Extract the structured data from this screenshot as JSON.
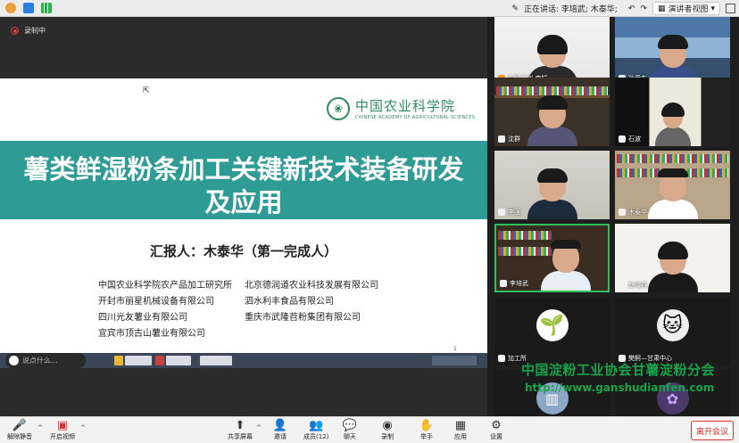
{
  "topbar": {
    "speaker_text": "正在讲话: 李培武; 木泰华;",
    "view_button": "演讲者视图"
  },
  "recording": {
    "label": "录制中"
  },
  "slide": {
    "logo_cn": "中国农业科学院",
    "logo_en": "CHINESE ACADEMY OF AGRICULTURAL SCIENCES",
    "title_line1": "薯类鲜湿粉条加工关键新技术装备研发",
    "title_line2": "及应用",
    "reporter": "汇报人：木泰华（第一完成人）",
    "orgs": [
      [
        "中国农业科学院农产品加工研究所",
        "北京德润道农业科技发展有限公司"
      ],
      [
        "开封市丽星机械设备有限公司",
        "泗水利丰食品有限公司"
      ],
      [
        "四川光友薯业有限公司",
        "重庆市武隆苕粉集团有限公司"
      ],
      [
        "宜宾市顶古山薯业有限公司",
        ""
      ]
    ],
    "page_number": "1"
  },
  "chat_pill": {
    "placeholder": "说点什么..."
  },
  "participants": [
    {
      "name": "中科合创-李娟",
      "mic": "orange"
    },
    {
      "name": "孙爱东",
      "mic": "white"
    },
    {
      "name": "沈群",
      "mic": "white"
    },
    {
      "name": "石波",
      "mic": "white"
    },
    {
      "name": "李强",
      "mic": "white"
    },
    {
      "name": "木泰华",
      "mic": "white"
    },
    {
      "name": "李培武",
      "mic": "white"
    },
    {
      "name": "赵晓燕",
      "mic": "white"
    },
    {
      "name": "加工所",
      "mic": "white"
    },
    {
      "name": "樊舸—甘肃中心",
      "mic": "white"
    }
  ],
  "watermark": {
    "line1": "中国淀粉工业协会甘薯淀粉分会",
    "line2": "http://www.ganshudianfen.com"
  },
  "toolbar": {
    "mute": "解除静音",
    "video": "开启视频",
    "share": "共享屏幕",
    "invite": "邀请",
    "members": "成员(12)",
    "chat": "聊天",
    "record": "录制",
    "raise": "举手",
    "apps": "应用",
    "settings": "设置",
    "leave": "离开会议"
  },
  "colors": {
    "band": "#2e9b95",
    "watermark": "#19a34a",
    "leave": "#dd2222"
  }
}
